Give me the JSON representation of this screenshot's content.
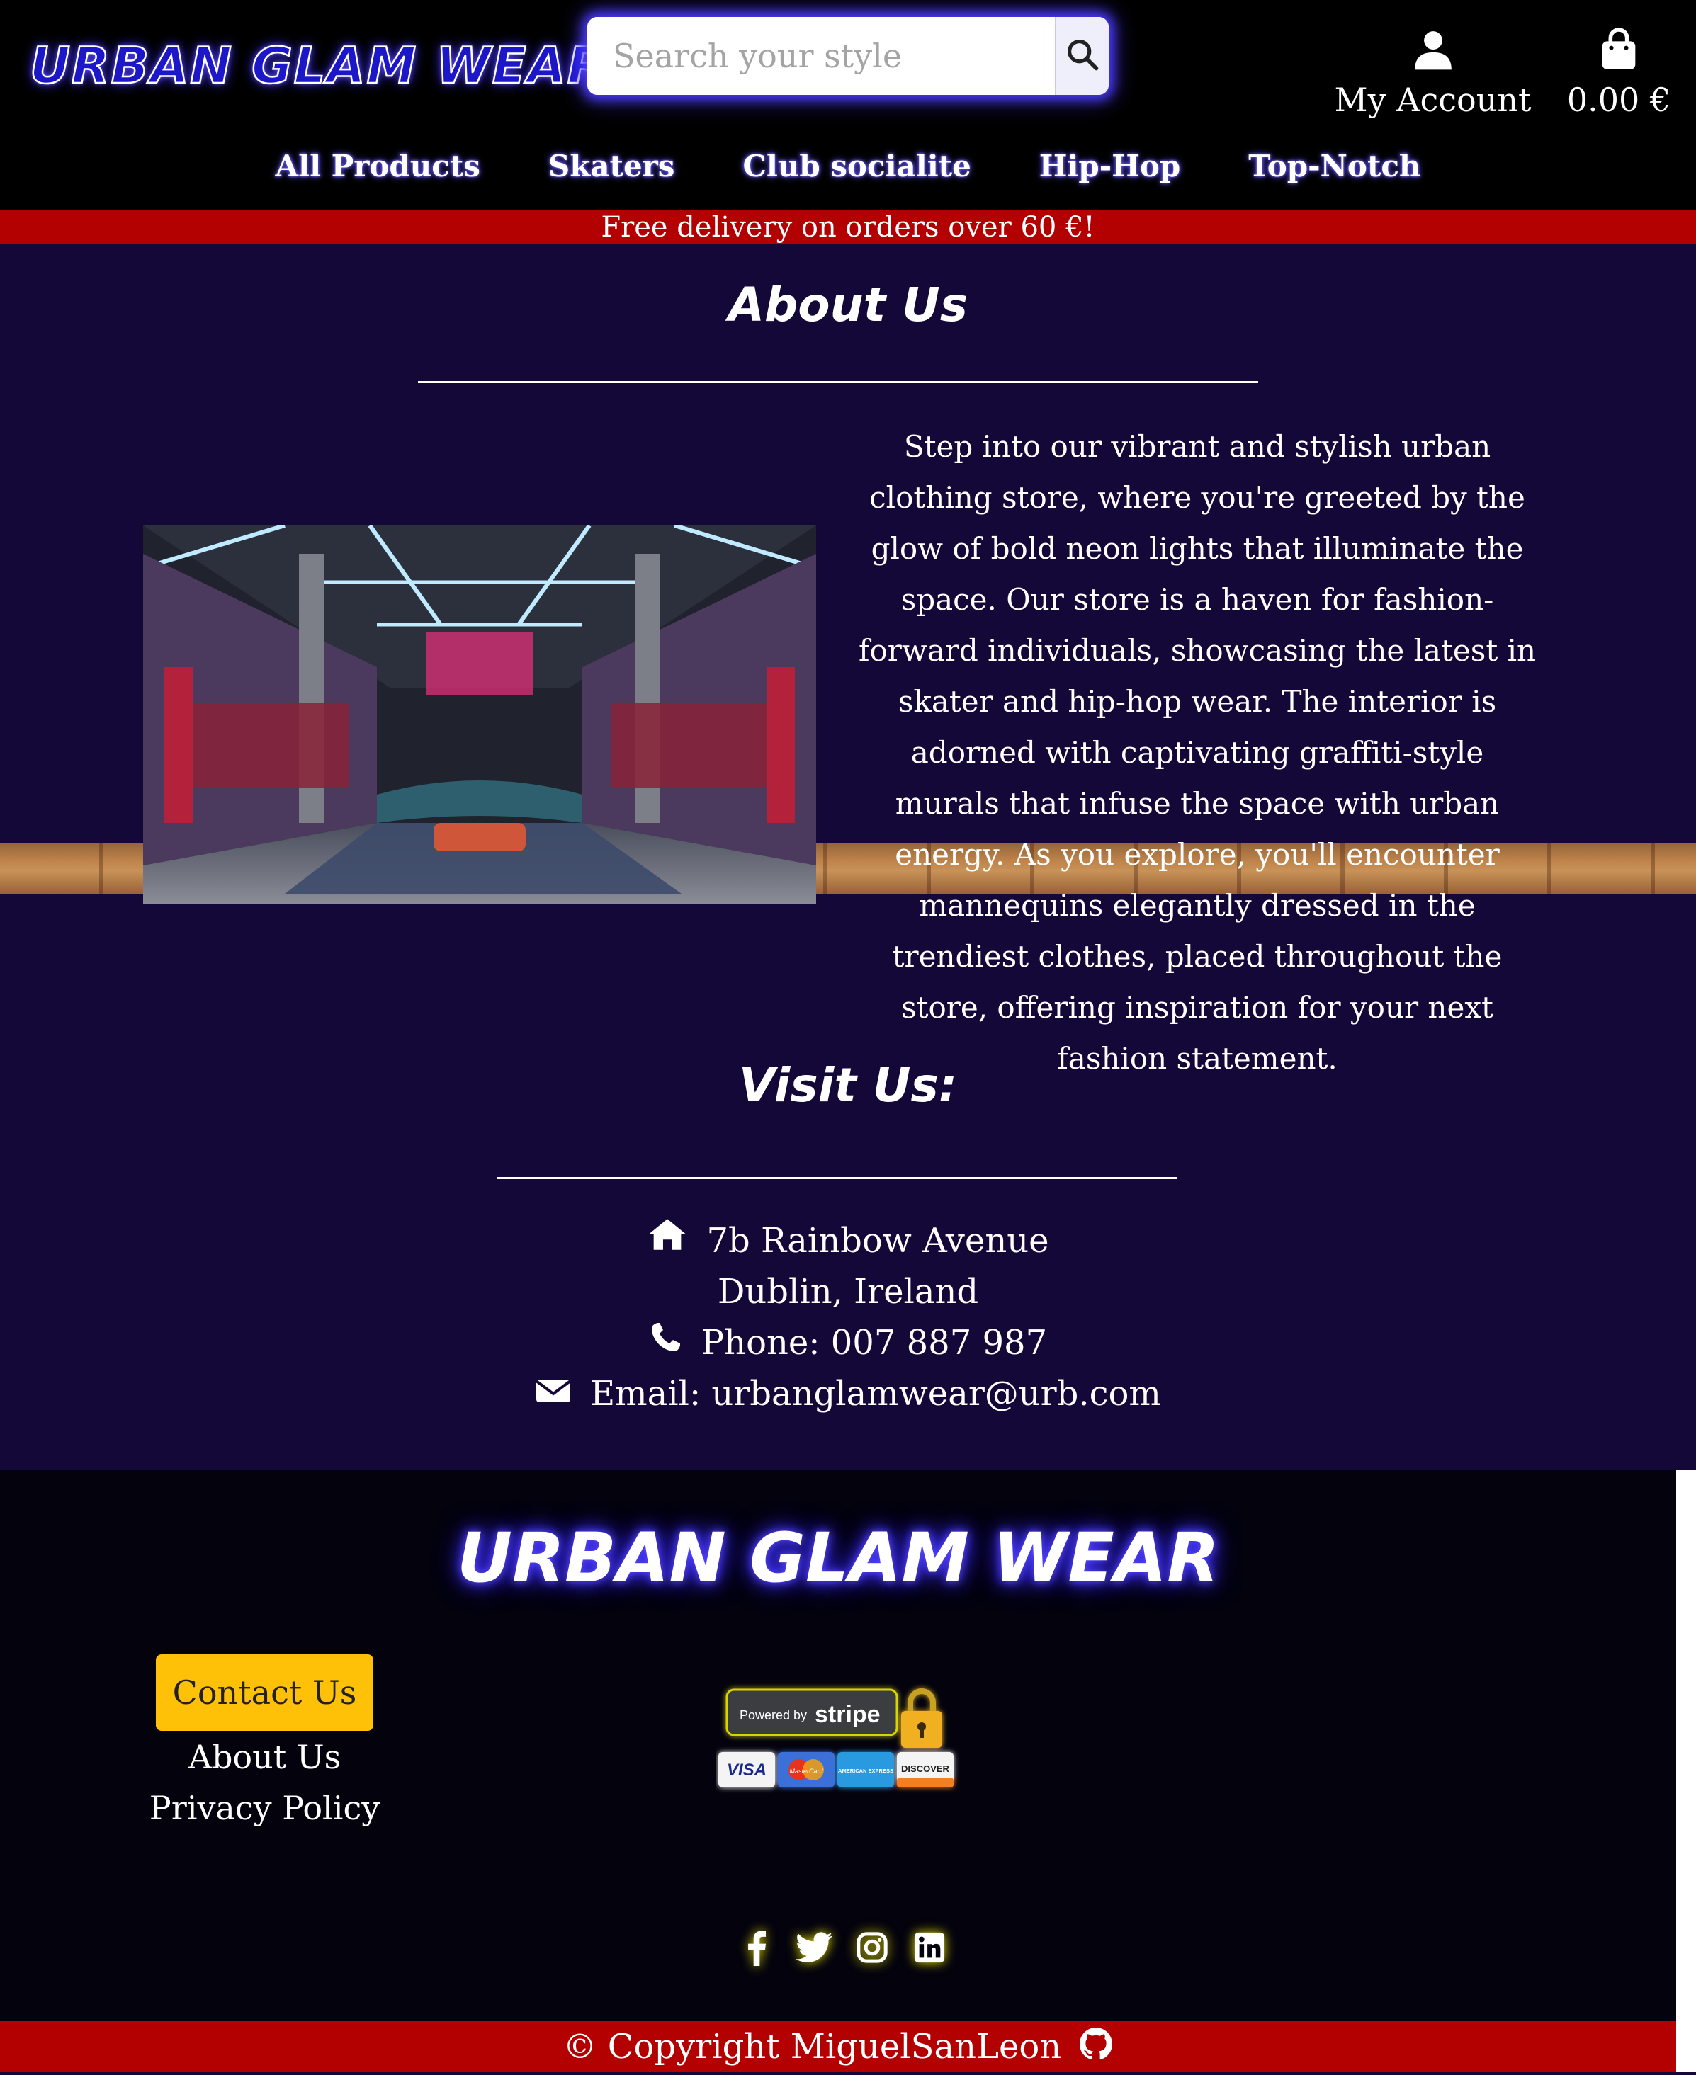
{
  "header": {
    "logo": "URBAN GLAM WEAR",
    "search_placeholder": "Search your style",
    "account_label": "My Account",
    "bag_total": "0.00 €"
  },
  "nav": [
    "All Products",
    "Skaters",
    "Club socialite",
    "Hip-Hop",
    "Top-Notch"
  ],
  "banner": "Free delivery on orders over 60 €!",
  "about": {
    "title": "About Us",
    "text": "Step into our vibrant and stylish urban clothing store, where you're greeted by the glow of bold neon lights that illuminate the space. Our store is a haven for fashion-forward individuals, showcasing the latest in skater and hip-hop wear. The interior is adorned with captivating graffiti-style murals that infuse the space with urban energy. As you explore, you'll encounter mannequins elegantly dressed in the trendiest clothes, placed throughout the store, offering inspiration for your next fashion statement."
  },
  "visit": {
    "title": "Visit Us:",
    "address_line1": "7b Rainbow Avenue",
    "address_line2": "Dublin, Ireland",
    "phone": "Phone: 007 887 987",
    "email": "Email: urbanglamwear@urb.com"
  },
  "footer": {
    "logo": "URBAN GLAM WEAR",
    "contact_button": "Contact Us",
    "about_link": "About Us",
    "privacy_link": "Privacy Policy",
    "stripe_powered_by": "Powered by",
    "stripe_brand": "stripe",
    "cards": [
      "VISA",
      "MasterCard",
      "AMERICAN EXPRESS",
      "DISCOVER"
    ],
    "social_icons": [
      "facebook-icon",
      "twitter-icon",
      "instagram-icon",
      "linkedin-icon"
    ],
    "copyright": "© Copyright MiguelSanLeon"
  },
  "colors": {
    "page_bg": "#140838",
    "header_bg": "#000000",
    "banner_red": "#b30000",
    "accent_blue": "#1c17c8",
    "button_yellow": "#ffc107",
    "footer_bg": "#03020d"
  }
}
